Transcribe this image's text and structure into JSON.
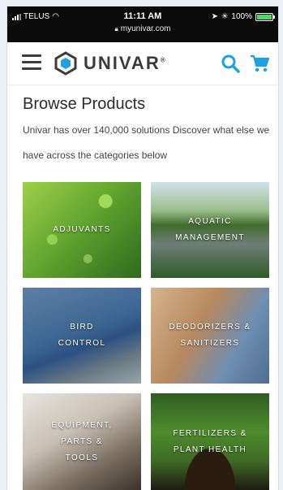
{
  "status_bar": {
    "carrier": "TELUS",
    "time": "11:11 AM",
    "url": "myunivar.com",
    "battery": "100%",
    "battery_color": "#4cd964"
  },
  "header": {
    "logo_text": "UNIVAR",
    "logo_reg": "®",
    "brand_color": "#1da1e0",
    "icons": [
      "hamburger-menu-icon",
      "search-icon",
      "cart-icon"
    ]
  },
  "main": {
    "title": "Browse Products",
    "description": "Univar has over 140,000 solutions  Discover what else we have across the categories below",
    "categories": [
      {
        "label": "ADJUVANTS"
      },
      {
        "label": "AQUATIC MANAGEMENT"
      },
      {
        "label": "BIRD CONTROL"
      },
      {
        "label": "DEODORIZERS & SANITIZERS"
      },
      {
        "label": "EQUIPMENT, PARTS & TOOLS"
      },
      {
        "label": "FERTILIZERS & PLANT HEALTH"
      }
    ]
  }
}
